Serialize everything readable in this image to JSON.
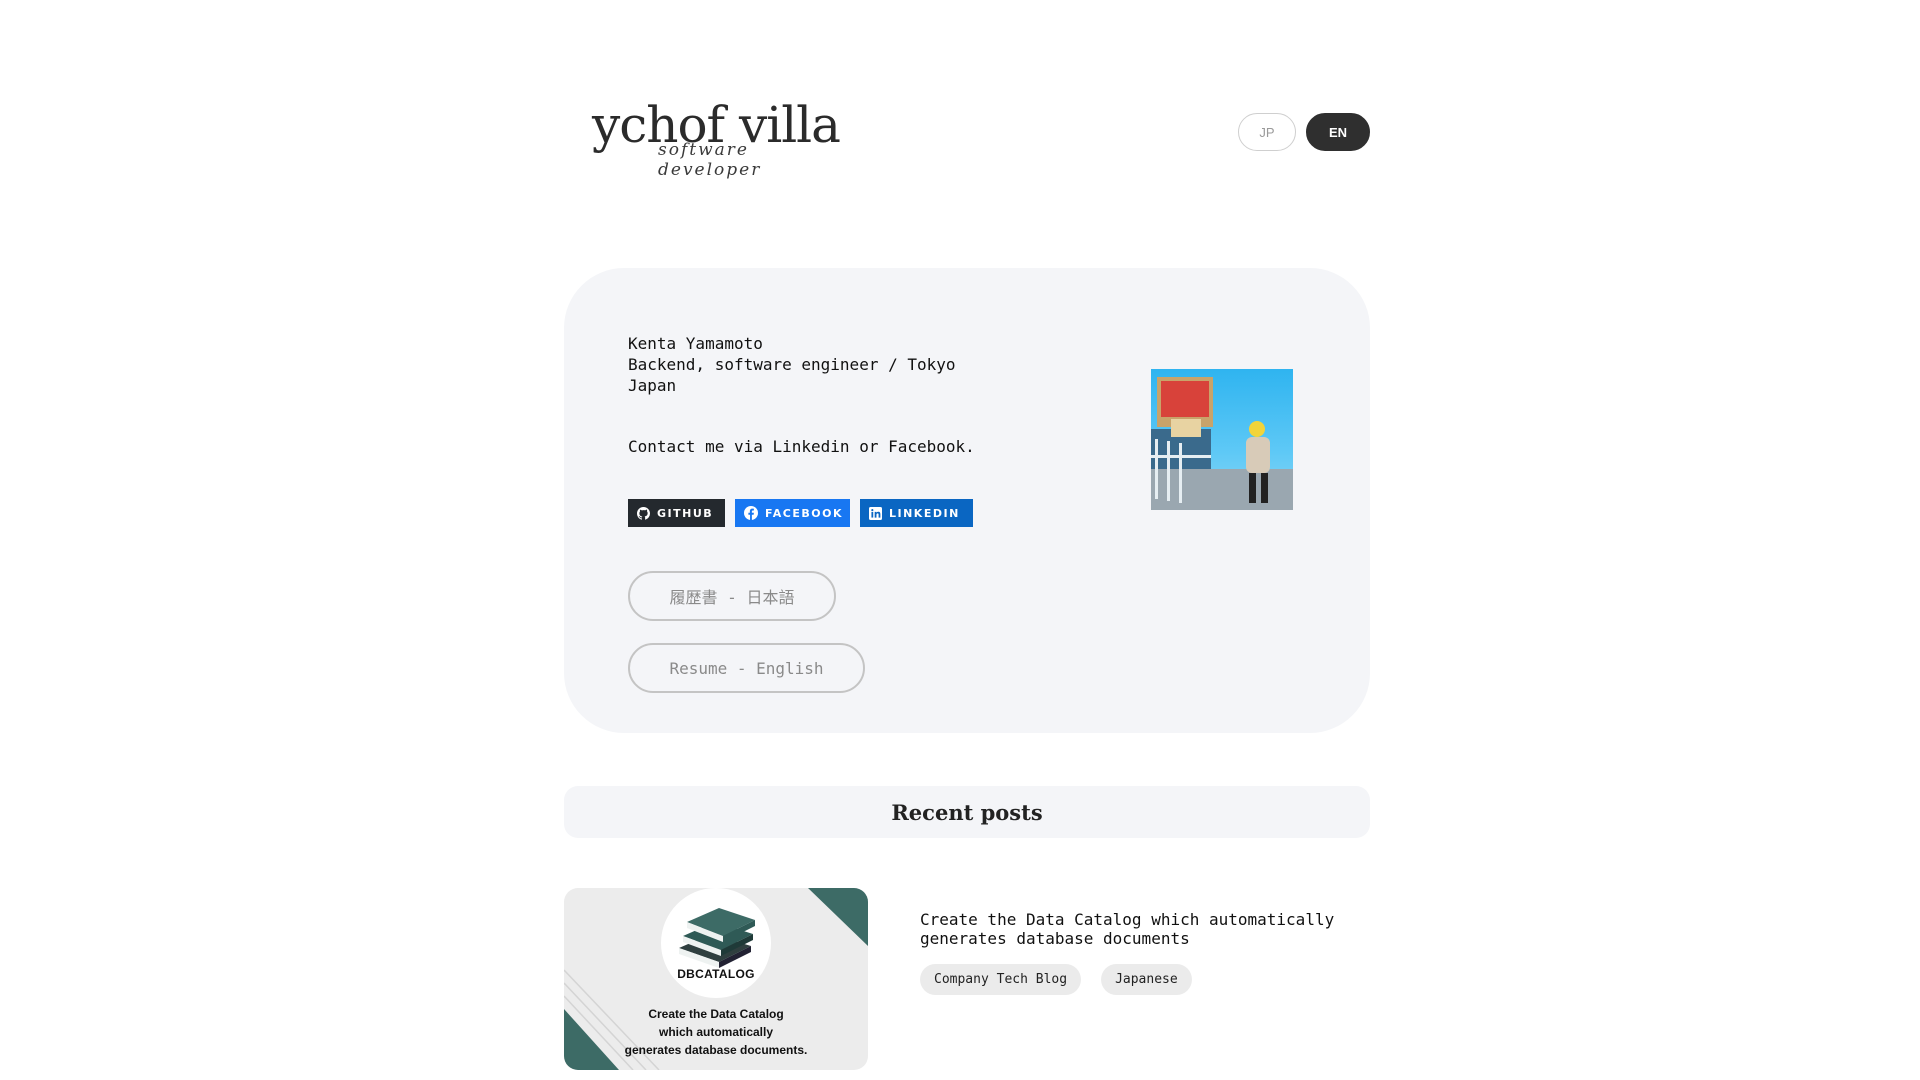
{
  "header": {
    "logo_main": "ychof villa",
    "logo_sub": "software developer",
    "lang_options": [
      "JP",
      "EN"
    ],
    "active_lang": "EN"
  },
  "profile": {
    "lines": [
      "Kenta Yamamoto",
      "Backend, software engineer / Tokyo",
      "Japan"
    ],
    "contact": "Contact me via Linkedin or Facebook.",
    "social": [
      {
        "label": "GITHUB",
        "icon": "github-icon",
        "color": "#24292e"
      },
      {
        "label": "FACEBOOK",
        "icon": "facebook-icon",
        "color": "#1877f2"
      },
      {
        "label": "LINKEDIN",
        "icon": "linkedin-icon",
        "color": "#0a66c2"
      }
    ],
    "resume_jp": "履歴書 - 日本語",
    "resume_en": "Resume - English"
  },
  "recent": {
    "title": "Recent posts"
  },
  "posts": [
    {
      "thumb_brand": "DBCATALOG",
      "thumb_text": [
        "Create the Data Catalog",
        "which automatically",
        "generates database documents."
      ],
      "title": "Create the Data Catalog which automatically generates database documents",
      "tags": [
        "Company Tech Blog",
        "Japanese"
      ]
    }
  ]
}
